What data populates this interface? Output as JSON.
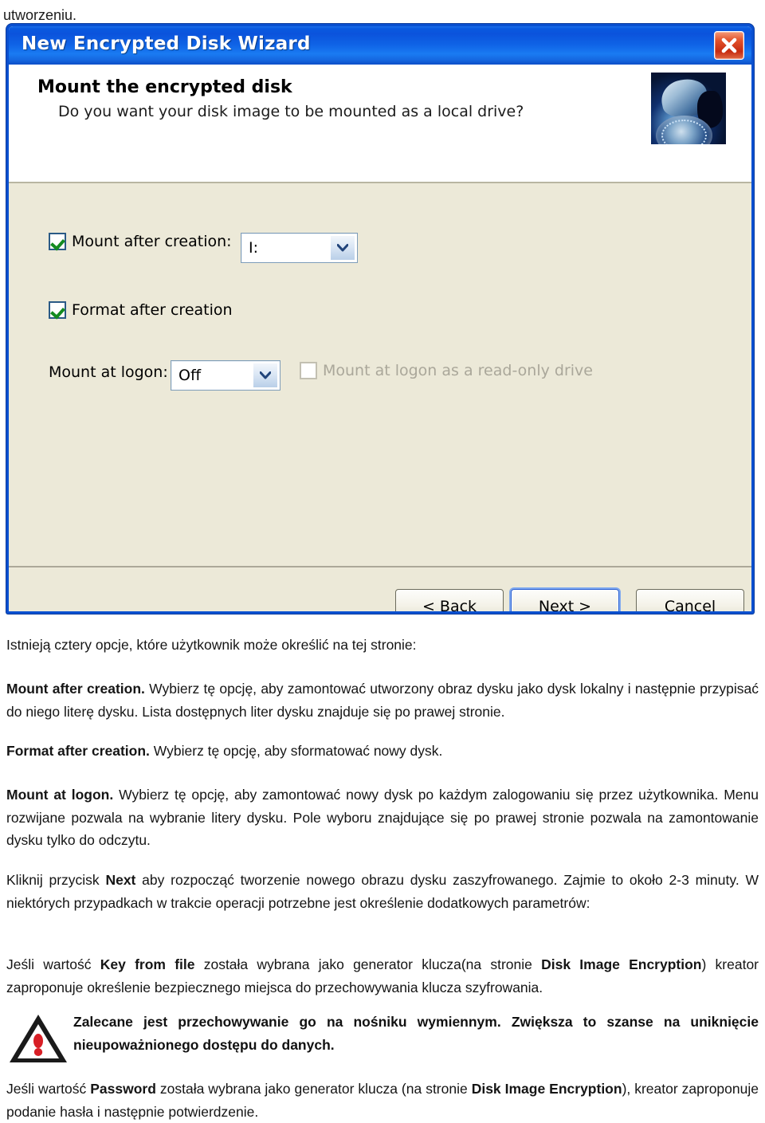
{
  "page": {
    "top_fragment": "utworzeniu."
  },
  "dialog": {
    "title": "New Encrypted Disk Wizard",
    "close_icon": "close-icon",
    "header": {
      "heading": "Mount the encrypted disk",
      "subheading": "Do you want your disk image to be mounted as a local drive?",
      "illustration": "encrypted-disk-vault-image"
    },
    "fields": {
      "mount_after_creation_label": "Mount after creation:",
      "mount_after_creation_checked": true,
      "drive_letter_value": "I:",
      "format_after_creation_label": "Format after creation",
      "format_after_creation_checked": true,
      "mount_at_logon_label": "Mount at logon:",
      "mount_at_logon_value": "Off",
      "readonly_label": "Mount at logon as a read-only drive",
      "readonly_checked": false,
      "readonly_disabled": true
    },
    "buttons": {
      "back": "< Back",
      "next": "Next >",
      "cancel": "Cancel"
    },
    "colors": {
      "titlebar_blue": "#0a50d0",
      "dialog_face": "#ece9d8",
      "close_red": "#c62b10",
      "check_green": "#138a20"
    }
  },
  "body_text": {
    "intro": "Istnieją cztery opcje, które użytkownik może określić na tej stronie:",
    "p1_bold": "Mount after creation.",
    "p1_rest": " Wybierz tę opcję, aby zamontować utworzony obraz dysku jako dysk lokalny i następnie przypisać do niego literę dysku. Lista dostępnych liter dysku znajduje się po prawej stronie.",
    "p2_bold": "Format after creation.",
    "p2_rest": " Wybierz tę opcję, aby sformatować nowy dysk.",
    "p3_bold": "Mount at logon.",
    "p3_rest": " Wybierz tę opcję, aby zamontować nowy dysk po każdym zalogowaniu się przez użytkownika. Menu rozwijane pozwala na wybranie litery dysku. Pole wyboru znajdujące się po prawej stronie pozwala na zamontowanie dysku tylko do odczytu.",
    "p4_a": "Kliknij przycisk ",
    "p4_bold": "Next",
    "p4_b": " aby rozpocząć tworzenie nowego obrazu dysku zaszyfrowanego. Zajmie to około 2-3 minuty. W niektórych przypadkach w trakcie operacji potrzebne jest określenie dodatkowych parametrów:",
    "p5_a": "Jeśli wartość ",
    "p5_bold1": "Key from file",
    "p5_b": " została wybrana jako generator klucza(na stronie ",
    "p5_bold2": "Disk Image Encryption",
    "p5_c": ") kreator zaproponuje określenie bezpiecznego miejsca do przechowywania klucza szyfrowania.",
    "warning_icon": "warning-triangle-icon",
    "warning": "Zalecane jest przechowywanie go na nośniku wymiennym. Zwiększa to szanse na uniknięcie nieupoważnionego dostępu do danych.",
    "p6_a": "Jeśli wartość ",
    "p6_bold1": "Password",
    "p6_b": " została wybrana jako generator klucza (na stronie ",
    "p6_bold2": "Disk Image Encryption",
    "p6_c": "), kreator zaproponuje podanie hasła i następnie potwierdzenie."
  }
}
